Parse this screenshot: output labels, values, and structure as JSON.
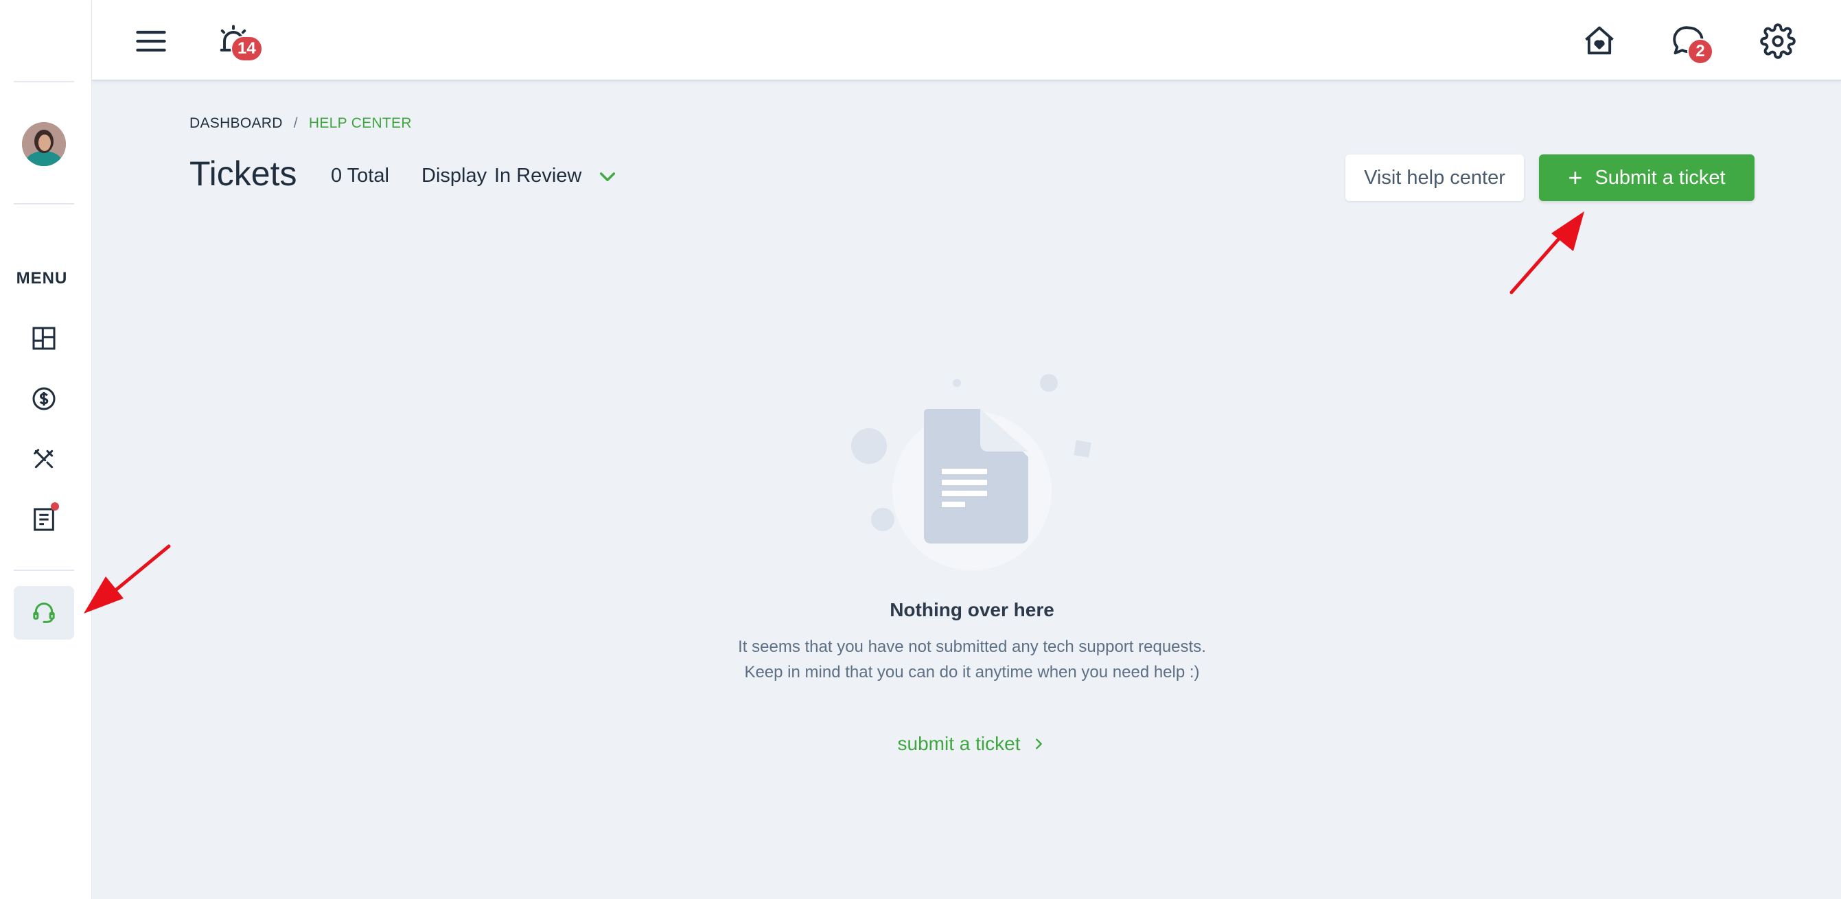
{
  "topbar": {
    "alarm_badge": "14",
    "chat_badge": "2"
  },
  "sidebar": {
    "menu_label": "MENU",
    "items": [
      {
        "icon": "dashboard-icon"
      },
      {
        "icon": "billing-icon"
      },
      {
        "icon": "tools-icon"
      },
      {
        "icon": "document-icon",
        "has_notification": true
      },
      {
        "icon": "headset-icon",
        "active": true
      }
    ]
  },
  "breadcrumb": {
    "dashboard": "DASHBOARD",
    "separator": "/",
    "current": "HELP CENTER"
  },
  "header": {
    "title": "Tickets",
    "total": "0 Total",
    "display_label": "Display",
    "display_value": "In Review"
  },
  "actions": {
    "visit_help_center": "Visit help center",
    "submit_ticket_plus": "+",
    "submit_ticket": "Submit a ticket"
  },
  "empty_state": {
    "title": "Nothing over here",
    "line1": "It seems that you have not submitted any tech support requests.",
    "line2": "Keep in mind that you can do it anytime when you need help :)",
    "link": "submit a ticket"
  },
  "colors": {
    "accent_green": "#41a943",
    "badge_red": "#d9434a",
    "background": "#eef2f7",
    "annotation_red": "#e8101a"
  }
}
